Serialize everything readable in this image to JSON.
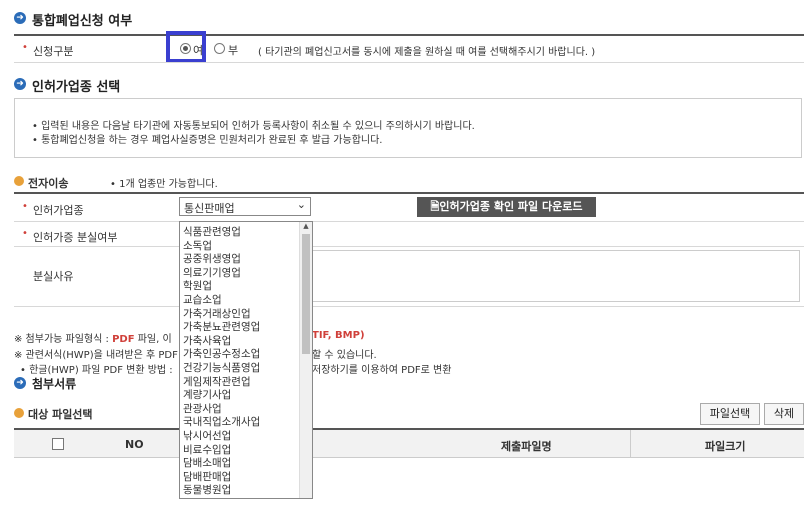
{
  "sec_close": {
    "title": "통합폐업신청 여부"
  },
  "apply_type": {
    "label": "신청구분",
    "opt_yes": "여",
    "opt_no": "부",
    "note": "( 타기관의 폐업신고서를 동시에 제출을 원하실 때 여를 선택해주시기 바랍니다. )"
  },
  "sec_license": {
    "title": "인허가업종 선택"
  },
  "notice": {
    "line1": "입력된 내용은 다음날 타기관에 자동통보되어 인허가 등록사항이 취소될 수 있으니 주의하시기 바랍니다.",
    "line2": "통합폐업신청을 하는 경우 폐업사실증명은 민원처리가 완료된 후 발급 가능합니다."
  },
  "transfer": {
    "label": "전자이송",
    "note": "1개 업종만 가능합니다."
  },
  "license_type": {
    "label": "인허가업종",
    "selected": "통신판매업",
    "download_button": "인허가업종 확인 파일 다운로드"
  },
  "lost": {
    "label": "인허가증 분실여부",
    "reason_label": "분실사유"
  },
  "dropdown_options": [
    "식품관련영업",
    "소독업",
    "공중위생영업",
    "의료기기영업",
    "학원업",
    "교습소업",
    "가축거래상인업",
    "가축분뇨관련영업",
    "가축사육업",
    "가축인공수정소업",
    "건강기능식품영업",
    "게임제작관련업",
    "계량기사업",
    "관광사업",
    "국내직업소개사업",
    "낚시어선업",
    "비료수입업",
    "담배소매업",
    "담배판매업",
    "동물병원업"
  ],
  "file_notes": {
    "line1a": "※ 첨부가능 파일형식 : ",
    "pdf": "PDF",
    "line1b": " 파일, 이",
    "line1c": "TIF, BMP)",
    "line2a": "※ 관련서식(HWP)을 내려받은 후 PDF",
    "line2b": "할 수 있습니다.",
    "line3a": "• 한글(HWP) 파일 PDF 변환 방법 : ",
    "line3b": "저장하기를 이용하여 PDF로 변환"
  },
  "sec_attach": {
    "title": "첨부서류"
  },
  "file_select": {
    "label": "대상 파일선택",
    "select_button": "파일선택",
    "delete_button": "삭제"
  },
  "table": {
    "col_no": "NO",
    "col_name": "제출파일명",
    "col_size": "파일크기"
  },
  "colors": {
    "accent": "#2b6cb8",
    "highlight_box": "#3a3fd0",
    "required": "#d0403a"
  }
}
